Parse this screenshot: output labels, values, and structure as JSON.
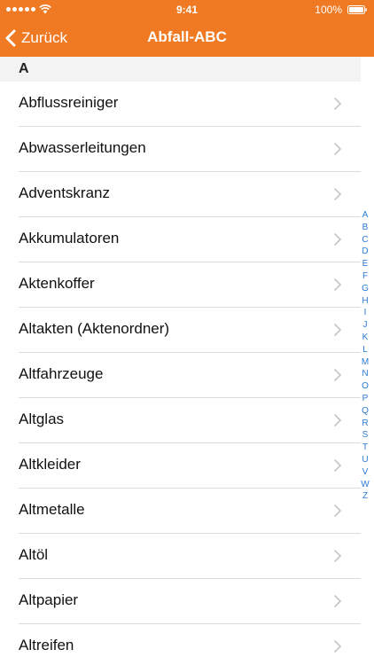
{
  "status_bar": {
    "time": "9:41",
    "battery_percent": "100%",
    "icons": [
      "signal-dots-icon",
      "wifi-icon",
      "battery-icon"
    ]
  },
  "nav_bar": {
    "back_label": "Zurück",
    "title": "Abfall-ABC",
    "color": "#f07a23"
  },
  "section": {
    "header": "A"
  },
  "items": [
    {
      "label": "Abflussreiniger"
    },
    {
      "label": "Abwasserleitungen"
    },
    {
      "label": "Adventskranz"
    },
    {
      "label": "Akkumulatoren"
    },
    {
      "label": "Aktenkoffer"
    },
    {
      "label": "Altakten (Aktenordner)"
    },
    {
      "label": "Altfahrzeuge"
    },
    {
      "label": "Altglas"
    },
    {
      "label": "Altkleider"
    },
    {
      "label": "Altmetalle"
    },
    {
      "label": "Altöl"
    },
    {
      "label": "Altpapier"
    },
    {
      "label": "Altreifen"
    }
  ],
  "index_letters": [
    "A",
    "B",
    "C",
    "D",
    "E",
    "F",
    "G",
    "H",
    "I",
    "J",
    "K",
    "L",
    "M",
    "N",
    "O",
    "P",
    "Q",
    "R",
    "S",
    "T",
    "U",
    "V",
    "W",
    "Z"
  ],
  "index_color": "#2a7bd5"
}
